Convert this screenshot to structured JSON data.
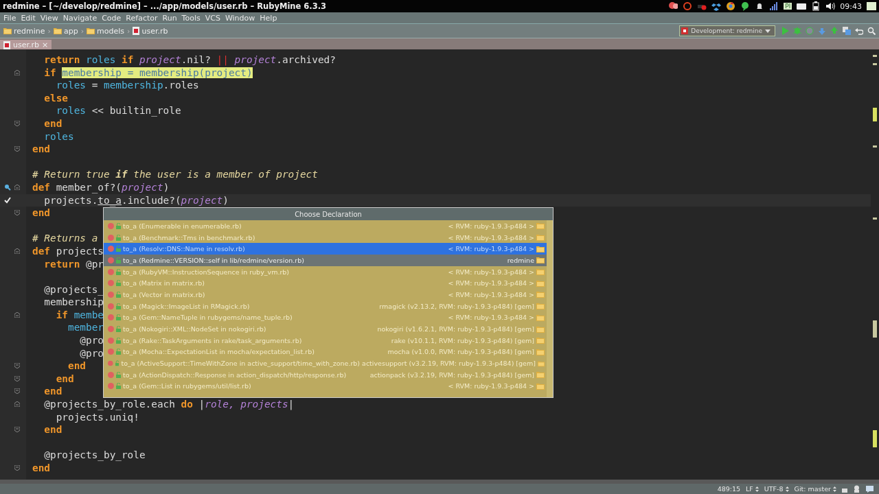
{
  "window": {
    "title": "redmine – [~/develop/redmine] – .../app/models/user.rb – RubyMine 6.3.3"
  },
  "tray": {
    "badge": "Pl",
    "clock": "09:43"
  },
  "menu": [
    "File",
    "Edit",
    "View",
    "Navigate",
    "Code",
    "Refactor",
    "Run",
    "Tools",
    "VCS",
    "Window",
    "Help"
  ],
  "breadcrumbs": [
    {
      "label": "redmine",
      "kind": "folder"
    },
    {
      "separator": "›",
      "label": "app",
      "kind": "folder"
    },
    {
      "separator": "›",
      "label": "models",
      "kind": "folder"
    },
    {
      "separator": "›",
      "label": "user.rb",
      "kind": "file"
    }
  ],
  "run_config": "Development: redmine",
  "tabs": [
    {
      "label": "user.rb",
      "close": "×",
      "selected": true
    }
  ],
  "code": [
    {
      "segs": [
        {
          "kind": "keyword",
          "text": "  return "
        },
        {
          "kind": "ident",
          "text": "roles "
        },
        {
          "kind": "keyword",
          "text": "if "
        },
        {
          "kind": "param",
          "text": "project"
        },
        {
          "kind": "plain",
          "text": ".nil? "
        },
        {
          "kind": "operator",
          "text": "||"
        },
        {
          "kind": "param",
          "text": " project"
        },
        {
          "kind": "plain",
          "text": ".archived?"
        }
      ]
    },
    {
      "fold_start": true,
      "segs": [
        {
          "kind": "keyword",
          "text": "  if "
        },
        {
          "kind": "highlight",
          "text": "membership = membership(project)"
        }
      ]
    },
    {
      "segs": [
        {
          "kind": "ident",
          "text": "    roles "
        },
        {
          "kind": "plain",
          "text": "= "
        },
        {
          "kind": "ident",
          "text": "membership"
        },
        {
          "kind": "plain",
          "text": ".roles"
        }
      ]
    },
    {
      "segs": [
        {
          "kind": "keyword",
          "text": "  else"
        }
      ]
    },
    {
      "segs": [
        {
          "kind": "ident",
          "text": "    roles "
        },
        {
          "kind": "plain",
          "text": "<< builtin_role"
        }
      ]
    },
    {
      "fold_end": true,
      "segs": [
        {
          "kind": "keyword",
          "text": "  end"
        }
      ]
    },
    {
      "segs": [
        {
          "kind": "ident",
          "text": "  roles"
        }
      ]
    },
    {
      "fold_end": true,
      "segs": [
        {
          "kind": "keyword",
          "text": "end"
        }
      ]
    },
    {
      "gap_before": true,
      "segs": [
        {
          "kind": "comment",
          "text": "# Return true "
        },
        {
          "kind": "comment_keyword",
          "text": "if"
        },
        {
          "kind": "comment",
          "text": " the user is a member of project"
        }
      ]
    },
    {
      "fold_start": true,
      "usage_marker": true,
      "segs": [
        {
          "kind": "keyword",
          "text": "def "
        },
        {
          "kind": "plain",
          "text": "member_of?("
        },
        {
          "kind": "param",
          "text": "project"
        },
        {
          "kind": "plain",
          "text": ")"
        }
      ]
    },
    {
      "current": true,
      "checkmark": true,
      "segs": [
        {
          "kind": "plain",
          "text": "  projects."
        },
        {
          "kind": "underlined",
          "text": "to_a"
        },
        {
          "kind": "plain",
          "text": ".include?("
        },
        {
          "kind": "param",
          "text": "project"
        },
        {
          "kind": "plain",
          "text": ")"
        }
      ]
    },
    {
      "fold_end": true,
      "segs": [
        {
          "kind": "keyword",
          "text": "end"
        }
      ]
    },
    {
      "gap_before": true,
      "segs": [
        {
          "kind": "comment",
          "text": "# Returns a"
        }
      ]
    },
    {
      "fold_start": true,
      "segs": [
        {
          "kind": "keyword",
          "text": "def "
        },
        {
          "kind": "plain",
          "text": "projects"
        }
      ]
    },
    {
      "segs": [
        {
          "kind": "keyword",
          "text": "  return "
        },
        {
          "kind": "plain",
          "text": "@pr"
        }
      ]
    },
    {
      "gap_before": true,
      "segs": [
        {
          "kind": "plain",
          "text": "  @projects_"
        }
      ]
    },
    {
      "segs": [
        {
          "kind": "plain",
          "text": "  membership"
        }
      ]
    },
    {
      "fold_start": true,
      "segs": [
        {
          "kind": "keyword",
          "text": "    if "
        },
        {
          "kind": "ident",
          "text": "membe"
        }
      ]
    },
    {
      "segs": [
        {
          "kind": "ident",
          "text": "      member"
        }
      ]
    },
    {
      "segs": [
        {
          "kind": "plain",
          "text": "        @pro"
        }
      ]
    },
    {
      "segs": [
        {
          "kind": "plain",
          "text": "        @pro"
        }
      ]
    },
    {
      "fold_end": true,
      "segs": [
        {
          "kind": "keyword",
          "text": "      end"
        }
      ]
    },
    {
      "fold_end": true,
      "segs": [
        {
          "kind": "keyword",
          "text": "    end"
        }
      ]
    },
    {
      "fold_end": true,
      "segs": [
        {
          "kind": "keyword",
          "text": "  end"
        }
      ]
    },
    {
      "fold_start": true,
      "segs": [
        {
          "kind": "plain",
          "text": "  @projects_by_role.each "
        },
        {
          "kind": "keyword",
          "text": "do"
        },
        {
          "kind": "plain",
          "text": " |"
        },
        {
          "kind": "param",
          "text": "role, projects"
        },
        {
          "kind": "plain",
          "text": "|"
        }
      ]
    },
    {
      "segs": [
        {
          "kind": "plain",
          "text": "    projects.uniq!"
        }
      ]
    },
    {
      "fold_end": true,
      "segs": [
        {
          "kind": "keyword",
          "text": "  end"
        }
      ]
    },
    {
      "gap_before": true,
      "segs": [
        {
          "kind": "plain",
          "text": "  @projects_by_role"
        }
      ]
    },
    {
      "fold_end": true,
      "segs": [
        {
          "kind": "keyword",
          "text": "end"
        }
      ]
    }
  ],
  "popup": {
    "title": "Choose Declaration",
    "items": [
      {
        "text": "to_a (Enumerable in enumerable.rb)",
        "location": "< RVM: ruby-1.9.3-p484 >",
        "selected": false,
        "kind": "library"
      },
      {
        "text": "to_a (Benchmark::Tms in benchmark.rb)",
        "location": "< RVM: ruby-1.9.3-p484 >",
        "selected": false,
        "kind": "library"
      },
      {
        "text": "to_a (Resolv::DNS::Name in resolv.rb)",
        "location": "< RVM: ruby-1.9.3-p484 >",
        "selected": true,
        "kind": "library"
      },
      {
        "text": "to_a (Redmine::VERSION::self in lib/redmine/version.rb)",
        "location": "redmine",
        "selected": false,
        "kind": "project"
      },
      {
        "text": "to_a (RubyVM::InstructionSequence in ruby_vm.rb)",
        "location": "< RVM: ruby-1.9.3-p484 >",
        "selected": false,
        "kind": "library"
      },
      {
        "text": "to_a (Matrix in matrix.rb)",
        "location": "< RVM: ruby-1.9.3-p484 >",
        "selected": false,
        "kind": "library"
      },
      {
        "text": "to_a (Vector in matrix.rb)",
        "location": "< RVM: ruby-1.9.3-p484 >",
        "selected": false,
        "kind": "library"
      },
      {
        "text": "to_a (Magick::ImageList in RMagick.rb)",
        "location": "rmagick (v2.13.2, RVM: ruby-1.9.3-p484) [gem]",
        "selected": false,
        "kind": "library"
      },
      {
        "text": "to_a (Gem::NameTuple in rubygems/name_tuple.rb)",
        "location": "< RVM: ruby-1.9.3-p484 >",
        "selected": false,
        "kind": "library"
      },
      {
        "text": "to_a (Nokogiri::XML::NodeSet in nokogiri.rb)",
        "location": "nokogiri (v1.6.2.1, RVM: ruby-1.9.3-p484) [gem]",
        "selected": false,
        "kind": "library"
      },
      {
        "text": "to_a (Rake::TaskArguments in rake/task_arguments.rb)",
        "location": "rake (v10.1.1, RVM: ruby-1.9.3-p484) [gem]",
        "selected": false,
        "kind": "library"
      },
      {
        "text": "to_a (Mocha::ExpectationList in mocha/expectation_list.rb)",
        "location": "mocha (v1.0.0, RVM: ruby-1.9.3-p484) [gem]",
        "selected": false,
        "kind": "library"
      },
      {
        "text": "to_a (ActiveSupport::TimeWithZone in active_support/time_with_zone.rb)",
        "location": "activesupport (v3.2.19, RVM: ruby-1.9.3-p484) [gem]",
        "selected": false,
        "kind": "library"
      },
      {
        "text": "to_a (ActionDispatch::Response in action_dispatch/http/response.rb)",
        "location": "actionpack (v3.2.19, RVM: ruby-1.9.3-p484) [gem]",
        "selected": false,
        "kind": "library"
      },
      {
        "text": "to_a (Gem::List in rubygems/util/list.rb)",
        "location": "< RVM: ruby-1.9.3-p484 >",
        "selected": false,
        "kind": "library"
      }
    ]
  },
  "status_bar": {
    "position": "489:15",
    "line_separator": "LF",
    "encoding": "UTF-8",
    "vcs": "Git: master"
  }
}
